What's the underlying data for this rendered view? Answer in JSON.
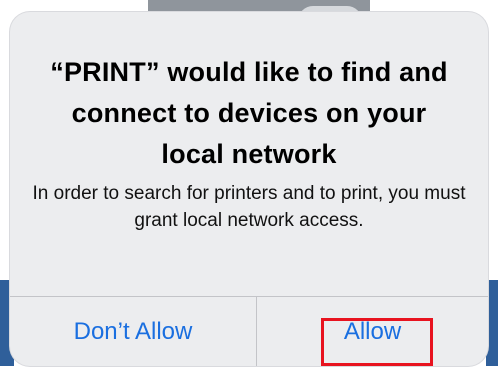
{
  "dialog": {
    "title": "“PRINT” would like to find and connect to devices on your local network",
    "message": "In order to search for printers and to print, you must grant local network access.",
    "buttons": {
      "deny_label": "Don’t Allow",
      "allow_label": "Allow"
    }
  },
  "colors": {
    "button_text": "#1a6fe0",
    "highlight": "#e8131f",
    "alert_background": "#ecedef"
  }
}
